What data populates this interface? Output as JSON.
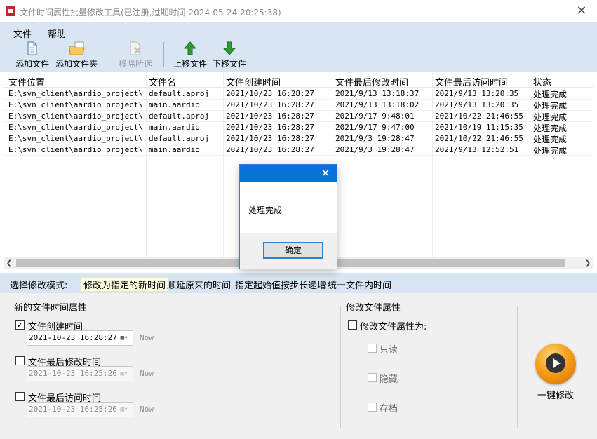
{
  "window": {
    "title": "文件时间属性批量修改工具(已注册,过期时间:2024-05-24 20:25:38)",
    "close_glyph": "✕"
  },
  "menu": {
    "items": [
      "文件",
      "帮助"
    ]
  },
  "toolbar": {
    "add_file": "添加文件",
    "add_folder": "添加文件夹",
    "remove_selected": "移除所选",
    "move_up": "上移文件",
    "move_down": "下移文件"
  },
  "table": {
    "headers": [
      "文件位置",
      "文件名",
      "文件创建时间",
      "文件最后修改时间",
      "文件最后访问时间",
      "状态"
    ],
    "rows": [
      [
        "E:\\svn_client\\aardio_project\\...",
        "default.aproj",
        "2021/10/23 16:28:27",
        "2021/9/13 13:18:37",
        "2021/9/13 13:20:35",
        "处理完成"
      ],
      [
        "E:\\svn_client\\aardio_project\\...",
        "main.aardio",
        "2021/10/23 16:28:27",
        "2021/9/13 13:18:02",
        "2021/9/13 13:20:35",
        "处理完成"
      ],
      [
        "E:\\svn_client\\aardio_project\\...",
        "default.aproj",
        "2021/10/23 16:28:27",
        "2021/9/17 9:48:01",
        "2021/10/22 21:46:55",
        "处理完成"
      ],
      [
        "E:\\svn_client\\aardio_project\\...",
        "main.aardio",
        "2021/10/23 16:28:27",
        "2021/9/17 9:47:00",
        "2021/10/19 11:15:35",
        "处理完成"
      ],
      [
        "E:\\svn_client\\aardio_project\\...",
        "default.aproj",
        "2021/10/23 16:28:27",
        "2021/9/3 19:28:47",
        "2021/10/22 21:46:55",
        "处理完成"
      ],
      [
        "E:\\svn_client\\aardio_project\\...",
        "main.aardio",
        "2021/10/23 16:28:27",
        "2021/9/3 19:28:47",
        "2021/9/13 12:52:51",
        "处理完成"
      ]
    ]
  },
  "mode_bar": {
    "label": "选择修改模式:",
    "options": [
      "修改为指定的新时间",
      "顺延原来的时间",
      "指定起始值按步长递增",
      "统一文件内时间"
    ],
    "selected": "修改为指定的新时间"
  },
  "time_group": {
    "title": "新的文件时间属性",
    "creation": {
      "label": "文件创建时间",
      "checked": true,
      "value": "2021-10-23 16:28:27",
      "now": "Now"
    },
    "modified": {
      "label": "文件最后修改时间",
      "checked": false,
      "value": "2021-10-23 16:25:26",
      "now": "Now"
    },
    "accessed": {
      "label": "文件最后访问时间",
      "checked": false,
      "value": "2021-10-23 16:25:26",
      "now": "Now"
    }
  },
  "attr_group": {
    "title": "修改文件属性",
    "main_label": "修改文件属性为:",
    "readonly": "只读",
    "hidden": "隐藏",
    "archive": "存档"
  },
  "action": {
    "label": "一键修改"
  },
  "dialog": {
    "close_glyph": "✕",
    "message": "处理完成",
    "ok_label": "确定"
  },
  "colors": {
    "accent": "#0a73d9",
    "band": "#d8e6f3",
    "go_button": "#f5a01a"
  }
}
